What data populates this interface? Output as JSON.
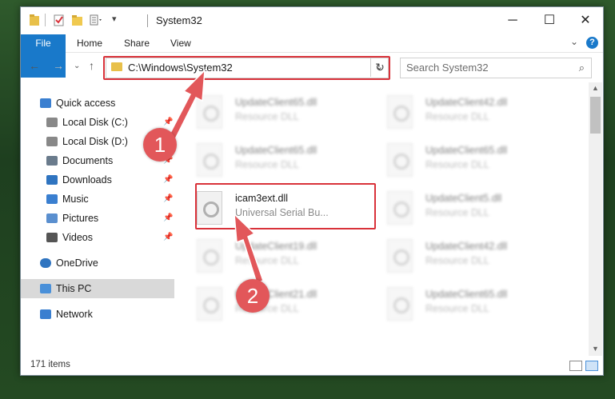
{
  "window": {
    "title": "System32"
  },
  "ribbon": {
    "tabs": [
      "File",
      "Home",
      "Share",
      "View"
    ],
    "help": "?"
  },
  "address": {
    "path": "C:\\Windows\\System32"
  },
  "search": {
    "placeholder": "Search System32"
  },
  "sidebar": {
    "items": [
      {
        "label": "Quick access",
        "icon": "star-icon",
        "pinned": false
      },
      {
        "label": "Local Disk (C:)",
        "icon": "drive-icon",
        "pinned": true
      },
      {
        "label": "Local Disk (D:)",
        "icon": "drive-icon",
        "pinned": false
      },
      {
        "label": "Documents",
        "icon": "documents-icon",
        "pinned": true
      },
      {
        "label": "Downloads",
        "icon": "download-icon",
        "pinned": true
      },
      {
        "label": "Music",
        "icon": "music-icon",
        "pinned": true
      },
      {
        "label": "Pictures",
        "icon": "pictures-icon",
        "pinned": true
      },
      {
        "label": "Videos",
        "icon": "videos-icon",
        "pinned": true
      },
      {
        "label": "OneDrive",
        "icon": "cloud-icon",
        "pinned": false
      },
      {
        "label": "This PC",
        "icon": "computer-icon",
        "pinned": false,
        "selected": true
      },
      {
        "label": "Network",
        "icon": "network-icon",
        "pinned": false
      }
    ]
  },
  "files": {
    "left": [
      {
        "name": "UpdateClient65.dll",
        "type": "Resource DLL",
        "blurred": true
      },
      {
        "name": "UpdateClient65.dll",
        "type": "Resource DLL",
        "blurred": true
      },
      {
        "name": "icam3ext.dll",
        "type": "Universal Serial Bu...",
        "blurred": false
      },
      {
        "name": "UpdateClient19.dll",
        "type": "Resource DLL",
        "blurred": true
      },
      {
        "name": "UpdateClient21.dll",
        "type": "Resource DLL",
        "blurred": true
      }
    ],
    "right": [
      {
        "name": "UpdateClient42.dll",
        "type": "Resource DLL",
        "blurred": true
      },
      {
        "name": "UpdateClient65.dll",
        "type": "Resource DLL",
        "blurred": true
      },
      {
        "name": "UpdateClient5.dll",
        "type": "Resource DLL",
        "blurred": true
      },
      {
        "name": "UpdateClient42.dll",
        "type": "Resource DLL",
        "blurred": true
      },
      {
        "name": "UpdateClient65.dll",
        "type": "Resource DLL",
        "blurred": true
      }
    ]
  },
  "status": {
    "count": "171 items"
  },
  "callouts": {
    "one": "1",
    "two": "2"
  },
  "colors": {
    "accent": "#1979ca",
    "highlight": "#d9323a",
    "callout": "#e2575a"
  }
}
